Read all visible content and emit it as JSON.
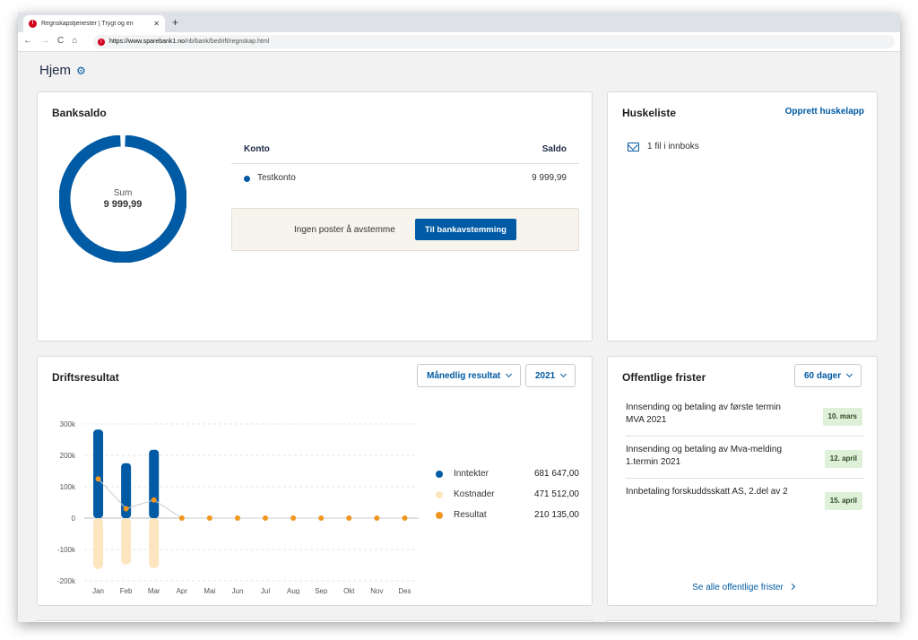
{
  "browser": {
    "tab_title": "Regnskapstjenester | Trygt og en",
    "url_domain": "https://www.sparebank1.no",
    "url_path": "/nb/bank/bedrift/regnskap.html"
  },
  "page": {
    "title": "Hjem"
  },
  "banksaldo": {
    "title": "Banksaldo",
    "sum_label": "Sum",
    "sum_value": "9 999,99",
    "col_account": "Konto",
    "col_balance": "Saldo",
    "accounts": [
      {
        "name": "Testkonto",
        "balance": "9 999,99",
        "color": "#005aa4"
      }
    ],
    "recon_text": "Ingen poster å avstemme",
    "recon_button": "Til bankavstemming"
  },
  "huskeliste": {
    "title": "Huskeliste",
    "create_link": "Opprett huskelapp",
    "inbox_text": "1 fil i innboks"
  },
  "driftsresultat": {
    "title": "Driftsresultat",
    "mode_select": "Månedlig resultat",
    "year_select": "2021",
    "legend": [
      {
        "label": "Inntekter",
        "value": "681 647,00",
        "color": "#005aa4"
      },
      {
        "label": "Kostnader",
        "value": "471 512,00",
        "color": "#fde5c0"
      },
      {
        "label": "Resultat",
        "value": "210 135,00",
        "color": "#f0961e"
      }
    ]
  },
  "chart_data": {
    "type": "bar",
    "categories": [
      "Jan",
      "Feb",
      "Mar",
      "Apr",
      "Mai",
      "Jun",
      "Jul",
      "Aug",
      "Sep",
      "Okt",
      "Nov",
      "Des"
    ],
    "ytick_labels": [
      "300k",
      "200k",
      "100k",
      "0",
      "-100k",
      "-200k"
    ],
    "ytick_values": [
      300000,
      200000,
      100000,
      0,
      -100000,
      -200000
    ],
    "ylim": [
      -200000,
      300000
    ],
    "grid": true,
    "legend_position": "right",
    "series": [
      {
        "name": "Inntekter",
        "kind": "bar",
        "values": [
          282000,
          175000,
          218000,
          0,
          0,
          0,
          0,
          0,
          0,
          0,
          0,
          0
        ]
      },
      {
        "name": "Kostnader",
        "kind": "bar",
        "values": [
          -162000,
          -148000,
          -160000,
          0,
          0,
          0,
          0,
          0,
          0,
          0,
          0,
          0
        ]
      },
      {
        "name": "Resultat",
        "kind": "line",
        "values": [
          125000,
          30000,
          58000,
          0,
          0,
          0,
          0,
          0,
          0,
          0,
          0,
          0
        ]
      }
    ]
  },
  "frister": {
    "title": "Offentlige frister",
    "period_select": "60 dager",
    "items": [
      {
        "text": "Innsending og betaling av første termin MVA 2021",
        "date": "10. mars"
      },
      {
        "text": "Innsending og betaling av Mva-melding 1.termin 2021",
        "date": "12. april"
      },
      {
        "text": "Innbetaling forskuddsskatt AS, 2.del av 2",
        "date": "15. april"
      }
    ],
    "see_all": "Se alle offentlige frister"
  }
}
